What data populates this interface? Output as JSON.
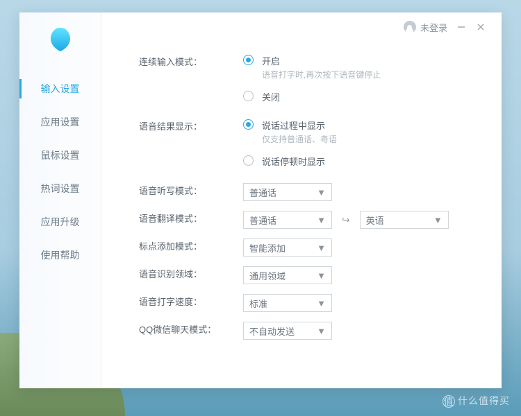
{
  "titlebar": {
    "login_text": "未登录"
  },
  "sidebar": {
    "items": [
      {
        "label": "输入设置",
        "active": true
      },
      {
        "label": "应用设置",
        "active": false
      },
      {
        "label": "鼠标设置",
        "active": false
      },
      {
        "label": "热词设置",
        "active": false
      },
      {
        "label": "应用升级",
        "active": false
      },
      {
        "label": "使用帮助",
        "active": false
      }
    ]
  },
  "settings": {
    "continuous_input": {
      "label": "连续输入模式：",
      "options": [
        {
          "text": "开启",
          "hint": "语音打字时,再次按下语音键停止",
          "checked": true
        },
        {
          "text": "关闭",
          "hint": "",
          "checked": false
        }
      ]
    },
    "voice_result_display": {
      "label": "语音结果显示：",
      "options": [
        {
          "text": "说话过程中显示",
          "hint": "仅支持普通话、粤语",
          "checked": true
        },
        {
          "text": "说话停顿时显示",
          "hint": "",
          "checked": false
        }
      ]
    },
    "dictation_mode": {
      "label": "语音听写模式：",
      "value": "普通话"
    },
    "translation_mode": {
      "label": "语音翻译模式：",
      "from": "普通话",
      "to": "英语"
    },
    "punctuation_mode": {
      "label": "标点添加模式：",
      "value": "智能添加"
    },
    "recognition_domain": {
      "label": "语音识别领域：",
      "value": "通用领域"
    },
    "typing_speed": {
      "label": "语音打字速度：",
      "value": "标准"
    },
    "qq_wechat_mode": {
      "label": "QQ微信聊天模式：",
      "value": "不自动发送"
    }
  },
  "watermark": "什么值得买"
}
